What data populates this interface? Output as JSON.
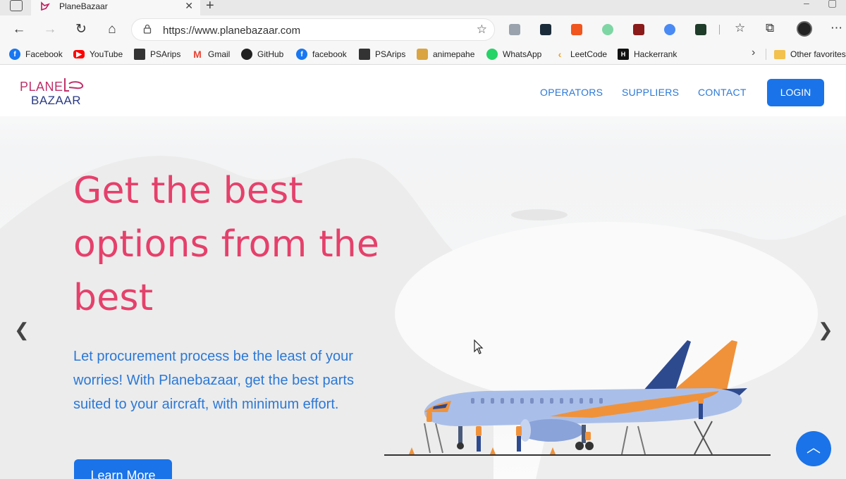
{
  "browser": {
    "tab": {
      "title": "PlaneBazaar"
    },
    "address": {
      "url": "https://www.planebazaar.com"
    },
    "bookmarks": [
      {
        "label": "Facebook",
        "icon": "facebook-icon",
        "color": "#1877f2"
      },
      {
        "label": "YouTube",
        "icon": "youtube-icon",
        "color": "#ff0000"
      },
      {
        "label": "PSArips",
        "icon": "psarips-icon",
        "color": "#333333"
      },
      {
        "label": "Gmail",
        "icon": "gmail-icon",
        "color": "#ea4335"
      },
      {
        "label": "GitHub",
        "icon": "github-icon",
        "color": "#222222"
      },
      {
        "label": "facebook",
        "icon": "facebook-icon",
        "color": "#1877f2"
      },
      {
        "label": "PSArips",
        "icon": "psarips-icon",
        "color": "#333333"
      },
      {
        "label": "animepahe",
        "icon": "animepahe-icon",
        "color": "#d9a441"
      },
      {
        "label": "WhatsApp",
        "icon": "whatsapp-icon",
        "color": "#25d366"
      },
      {
        "label": "LeetCode",
        "icon": "leetcode-icon",
        "color": "#f0a020"
      },
      {
        "label": "Hackerrank",
        "icon": "hackerrank-icon",
        "color": "#111111"
      }
    ],
    "other_favorites": "Other favorites"
  },
  "site": {
    "logo": {
      "line1": "PLANE",
      "line2": "BAZAAR"
    },
    "nav": [
      "OPERATORS",
      "SUPPLIERS",
      "CONTACT"
    ],
    "login_label": "LOGIN",
    "hero": {
      "headline": "Get the best options from the best",
      "subtext": "Let procurement process be the least of your worries! With Planebazaar, get the best parts suited to your aircraft, with minimum effort.",
      "cta_label": "Learn More"
    },
    "colors": {
      "accent": "#1a73e8",
      "headline": "#e5406b",
      "link": "#2b78d6"
    }
  }
}
